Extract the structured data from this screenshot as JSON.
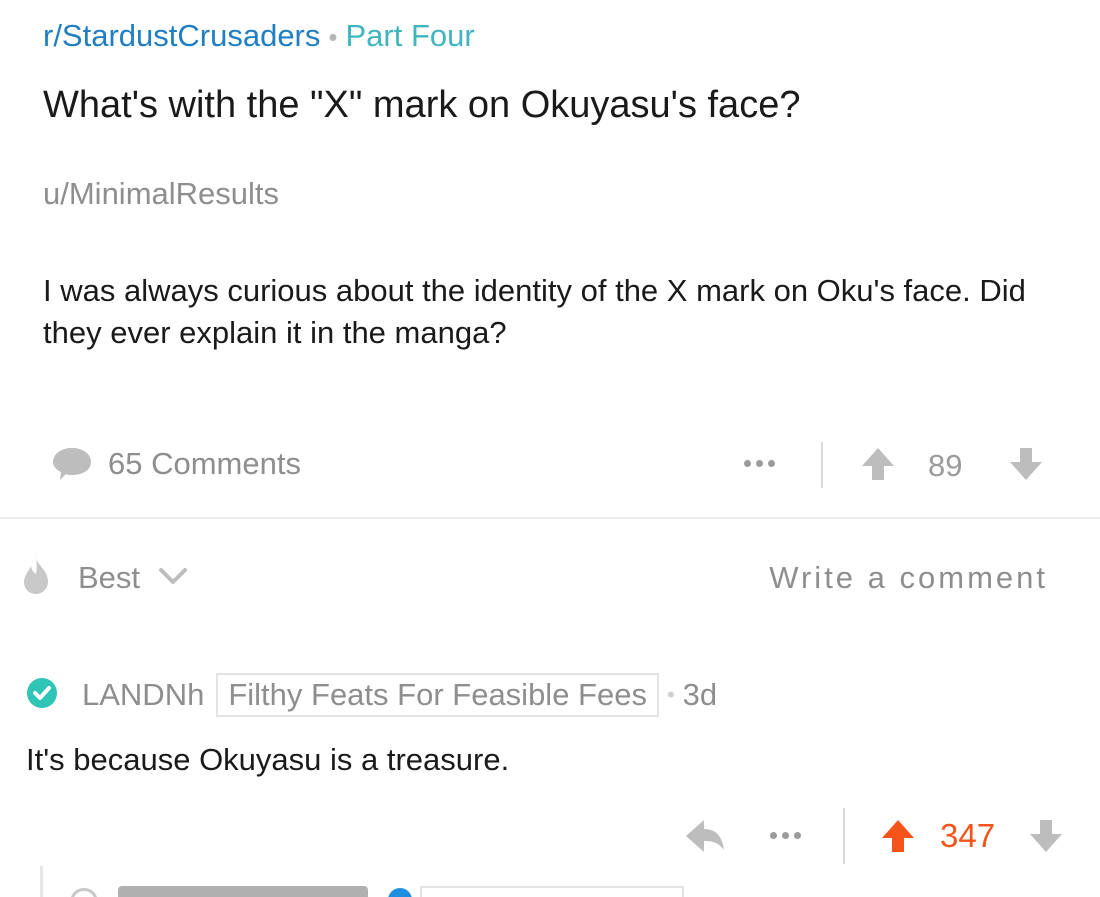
{
  "post": {
    "subreddit": "r/StardustCrusaders",
    "separator": "•",
    "flair": "Part Four",
    "title": "What's with the \"X\" mark on Okuyasu's face?",
    "author": "u/MinimalResults",
    "body": "I was always curious about the identity of the X mark on Oku's face. Did they ever explain it in the manga?",
    "comments_label": "65 Comments",
    "score": "89",
    "icons": {
      "comments": "speech-bubble-icon",
      "more": "more-dots-icon",
      "upvote": "upvote-arrow-icon",
      "downvote": "downvote-arrow-icon"
    }
  },
  "sort": {
    "label": "Best",
    "icon": "flame-icon",
    "chevron": "chevron-down-icon",
    "write_comment": "Write a comment"
  },
  "comment": {
    "username": "LANDNh",
    "user_flair": "Filthy Feats For Feasible Fees",
    "separator": "•",
    "age": "3d",
    "body": "It's because Okuyasu is a treasure.",
    "score": "347",
    "icons": {
      "verified": "verified-check-icon",
      "reply": "reply-arrow-icon",
      "more": "more-dots-icon",
      "upvote": "upvote-arrow-icon",
      "downvote": "downvote-arrow-icon"
    }
  },
  "colors": {
    "subreddit_link": "#1f7fc2",
    "post_flair": "#3fb6be",
    "muted_text": "#8e8e8e",
    "upvoted": "#f4541a",
    "verified": "#2ec4b6",
    "icon_gray": "#bdbdbd"
  }
}
